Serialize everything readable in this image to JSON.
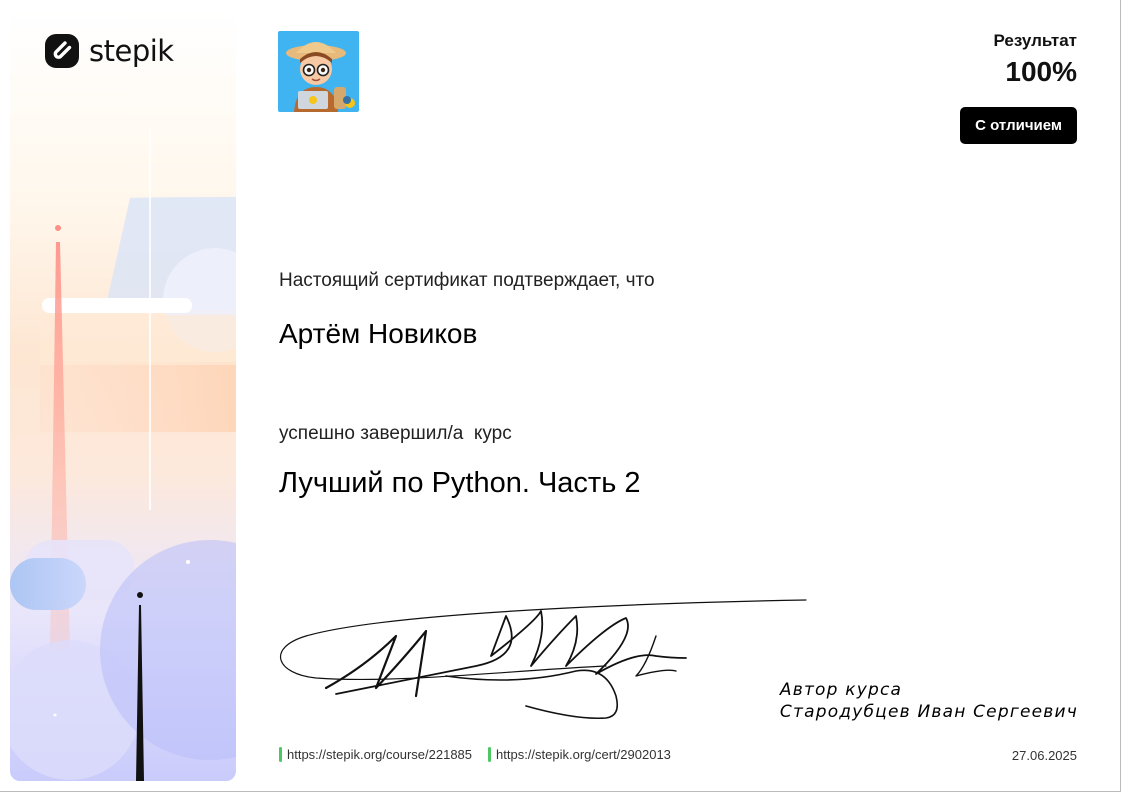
{
  "logo": {
    "text": "stepik",
    "icon": "stepik-logo-icon"
  },
  "avatar": {
    "icon": "python-explorer-avatar-icon"
  },
  "result": {
    "label": "Результат",
    "value": "100%",
    "badge": "С отличием"
  },
  "certificate": {
    "confirm_text": "Настоящий сертификат подтверждает, что",
    "student_name": "Артём Новиков",
    "completed_text": "успешно завершил/а  курс",
    "course_name": "Лучший по Python. Часть 2"
  },
  "author": {
    "role": "Автор курса",
    "name": "Стародубцев Иван Сергеевич"
  },
  "footer": {
    "course_url": "https://stepik.org/course/221885",
    "cert_url": "https://stepik.org/cert/2902013",
    "date": "27.06.2025"
  },
  "colors": {
    "accent": "#4cc764",
    "badge_bg": "#000000",
    "panel_pink": "#fde6d2",
    "panel_lavender": "#c9cbfb"
  }
}
